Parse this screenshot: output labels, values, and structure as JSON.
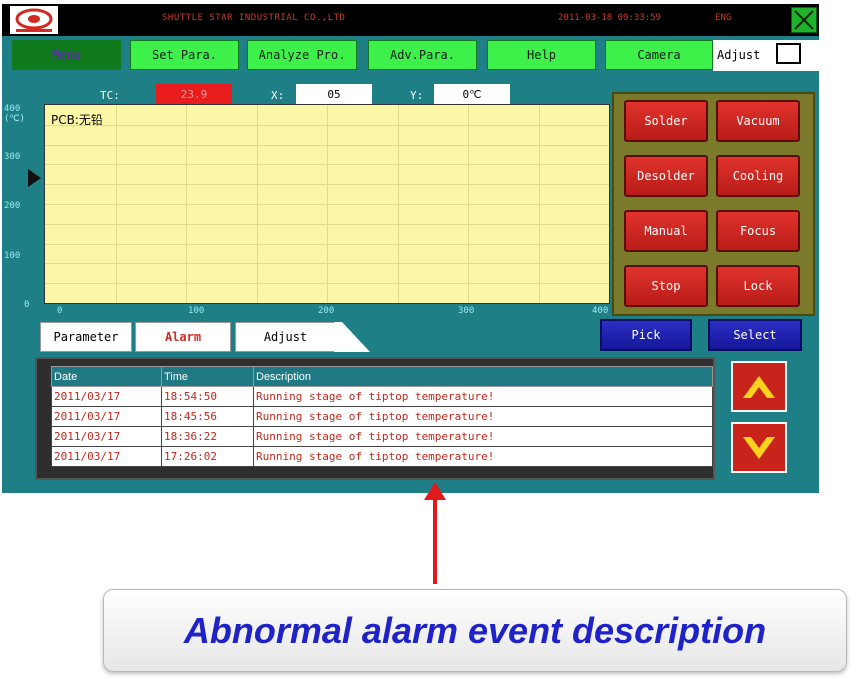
{
  "topbar": {
    "company": "SHUTTLE STAR INDUSTRIAL CO.,LTD",
    "datetime": "2011-03-18 09:33:59",
    "user": "ENG"
  },
  "menu": {
    "items": [
      "Menu",
      "Set Para.",
      "Analyze Pro.",
      "Adv.Para.",
      "Help",
      "Camera"
    ],
    "active": "Menu",
    "adjust_label": "Adjust"
  },
  "readouts": {
    "tc_label": "TC:",
    "tc_value": "23.9",
    "x_label": "X:",
    "x_value": "05",
    "y_label": "Y:",
    "y_value": "0℃"
  },
  "chart": {
    "y_ticks": [
      "400",
      "300",
      "200",
      "100",
      "0"
    ],
    "y_unit": "(℃)",
    "x_ticks": [
      "0",
      "100",
      "200",
      "300",
      "400"
    ],
    "pcb_label": "PCB:无铅"
  },
  "control_buttons": [
    "Solder",
    "Vacuum",
    "Desolder",
    "Cooling",
    "Manual",
    "Focus",
    "Stop",
    "Lock"
  ],
  "bottom_buttons": {
    "pick": "Pick",
    "select": "Select"
  },
  "tabs": [
    "Parameter",
    "Alarm",
    "Adjust"
  ],
  "active_tab": "Alarm",
  "log": {
    "headers": [
      "Date",
      "Time",
      "Description"
    ],
    "rows": [
      [
        "2011/03/17",
        "18:54:50",
        "Running stage of tiptop temperature!"
      ],
      [
        "2011/03/17",
        "18:45:56",
        "Running stage of tiptop temperature!"
      ],
      [
        "2011/03/17",
        "18:36:22",
        "Running stage of tiptop temperature!"
      ],
      [
        "2011/03/17",
        "17:26:02",
        "Running stage of tiptop temperature!"
      ]
    ]
  },
  "caption": "Abnormal alarm event description",
  "colors": {
    "screen_bg": "#1e7f86",
    "menu_green": "#3df04a",
    "plot_yellow": "#fbf7a6",
    "control_red": "#d42a24",
    "pick_blue": "#2c2fc4",
    "caption_blue": "#1e22c8",
    "arrow_red": "#e01a1a"
  }
}
